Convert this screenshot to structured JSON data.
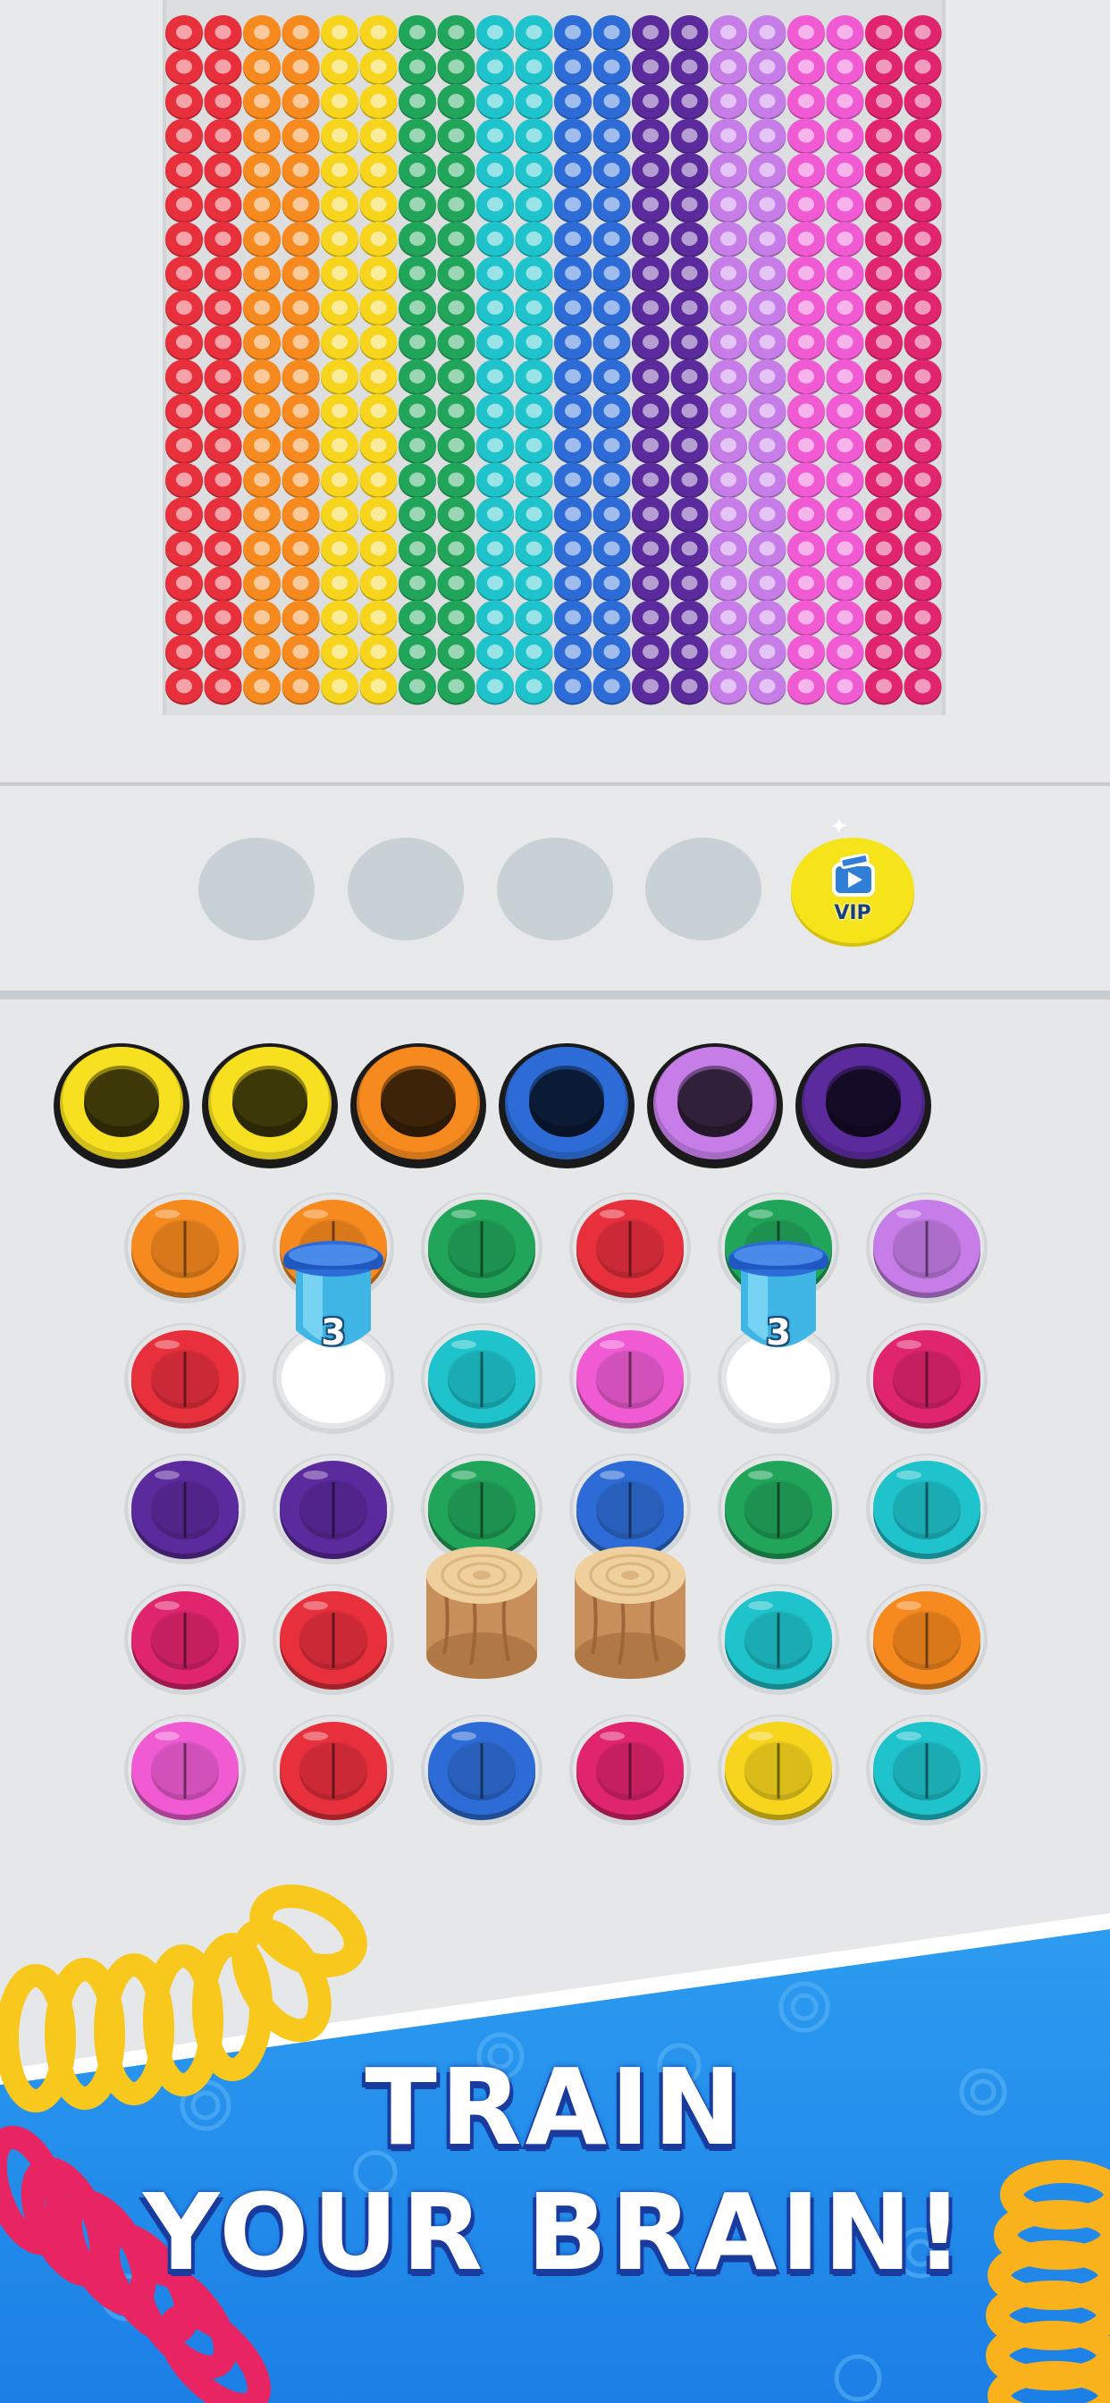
{
  "board": {
    "column_colors": [
      "#e8303d",
      "#e8303d",
      "#f68a1f",
      "#f68a1f",
      "#f7d51d",
      "#f7d51d",
      "#21a55a",
      "#21a55a",
      "#1ec3cc",
      "#1ec3cc",
      "#2d6cd6",
      "#2d6cd6",
      "#5b2a9c",
      "#5b2a9c",
      "#c67de8",
      "#c67de8",
      "#f05bd4",
      "#f05bd4",
      "#e0246e",
      "#e0246e"
    ],
    "rows": 20
  },
  "slots": {
    "empty_count": 4,
    "vip_label": "VIP"
  },
  "targets": [
    {
      "color": "#f7e01f"
    },
    {
      "color": "#f7e01f"
    },
    {
      "color": "#f68a1f"
    },
    {
      "color": "#2d6cd6"
    },
    {
      "color": "#c67de8"
    },
    {
      "color": "#5b2a9c"
    }
  ],
  "grid": [
    [
      "#f68a1f",
      "#f68a1f",
      "#21a55a",
      "#e8303d",
      "#21a55a",
      "#c67de8"
    ],
    [
      "#e8303d",
      "blocker",
      "#1ec3cc",
      "#f05bd4",
      "blocker",
      "#e0246e"
    ],
    [
      "#5b2a9c",
      "#5b2a9c",
      "#21a55a",
      "#2d6cd6",
      "#21a55a",
      "#1ec3cc"
    ],
    [
      "#e0246e",
      "#e8303d",
      "wood",
      "wood",
      "#1ec3cc",
      "#f68a1f"
    ],
    [
      "#f05bd4",
      "#e8303d",
      "#2d6cd6",
      "#e0246e",
      "#f7d51d",
      "#1ec3cc"
    ]
  ],
  "blockers": {
    "count_left": "3",
    "count_right": "3"
  },
  "banner": {
    "line1": "TRAIN",
    "line2": "YOUR BRAIN!"
  }
}
